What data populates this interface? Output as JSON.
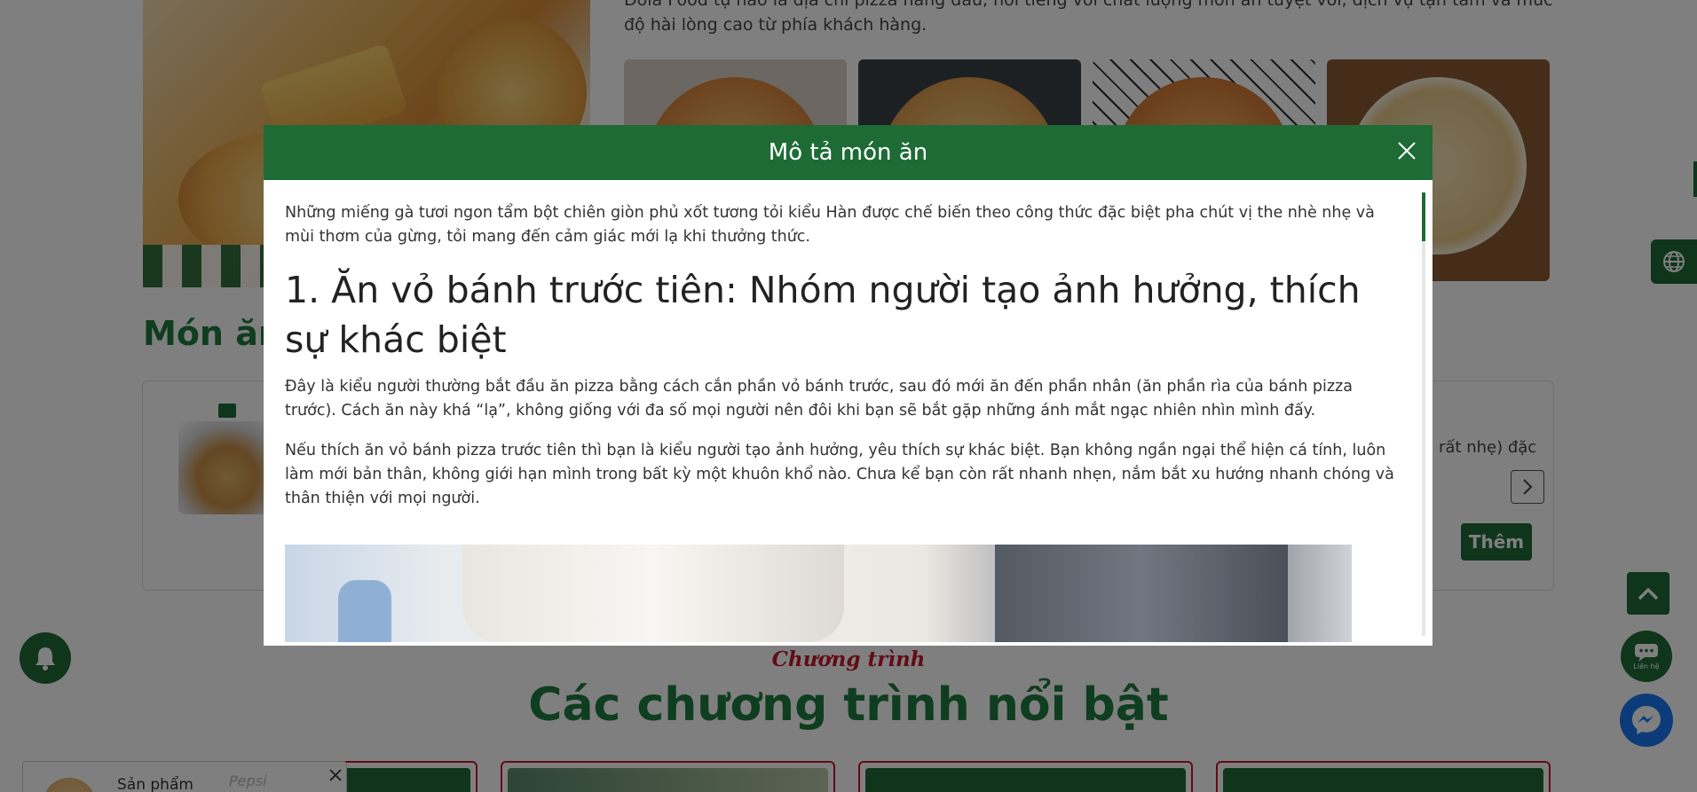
{
  "background": {
    "intro_text": "Dola Food tự hào là địa chỉ pizza hàng đầu, nổi tiếng với chất lượng món ăn tuyệt vời, dịch vụ tận tâm và mức độ hài lòng cao từ phía khách hàng.",
    "section_title": "Món ăn",
    "product": {
      "description_tail": "rất nhẹ) đặc",
      "add_label": "Thêm"
    },
    "program_kicker": "Chương trình",
    "program_title": "Các chương trình nổi bật",
    "toast": {
      "label": "Sản phẩm",
      "brand": "Pepsi"
    },
    "contact_label": "Liên hệ"
  },
  "modal": {
    "title": "Mô tả món ăn",
    "intro": "Những miếng gà tươi ngon tẩm bột chiên giòn phủ xốt tương tỏi kiểu Hàn được chế biến theo công thức đặc biệt pha chút vị the nhè nhẹ và mùi thơm của gừng, tỏi mang đến cảm giác mới lạ khi thưởng thức.",
    "heading": "1. Ăn vỏ bánh trước tiên: Nhóm người tạo ảnh hưởng, thích sự khác biệt",
    "paragraph1": "Đây là kiểu người thường bắt đầu ăn pizza bằng cách cắn phần vỏ bánh trước, sau đó mới ăn đến phần nhân (ăn phần rìa của bánh pizza trước). Cách ăn này khá “lạ”, không giống với đa số mọi người nên đôi khi bạn sẽ bắt gặp những ánh mắt ngạc nhiên nhìn mình đấy.",
    "paragraph2": "Nếu thích ăn vỏ bánh pizza trước tiên thì bạn là kiểu người tạo ảnh hưởng, yêu thích sự khác biệt. Bạn không ngần ngại thể hiện cá tính, luôn làm mới bản thân, không giới hạn mình trong bất kỳ một khuôn khổ nào. Chưa kể bạn còn rất nhanh nhẹn, nắm bắt xu hướng nhanh chóng và thân thiện với mọi người."
  },
  "icons": {
    "close": "close-icon",
    "globe": "globe-icon",
    "bell": "bell-icon",
    "chevron_up": "chevron-up-icon",
    "chevron_right": "chevron-right-icon",
    "chat": "chat-icon",
    "messenger": "messenger-icon"
  },
  "colors": {
    "brand_green": "#1e6b36",
    "accent_red": "#c4172c",
    "messenger_blue": "#1877f2"
  }
}
